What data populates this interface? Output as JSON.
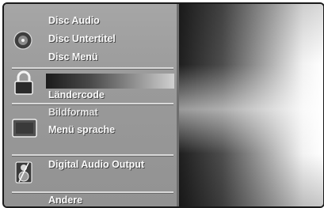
{
  "menu": {
    "disc_audio": "Disc Audio",
    "disc_subtitle": "Disc Untertitel",
    "disc_menu": "Disc Menü",
    "country_code": "Ländercode",
    "picture_format": "Bildformat",
    "menu_language": "Menü sprache",
    "digital_audio_output": "Digital Audio Output",
    "others": "Andere"
  },
  "icons": [
    "disc-icon",
    "lock-icon",
    "tv-screen-icon",
    "speaker-icon"
  ]
}
